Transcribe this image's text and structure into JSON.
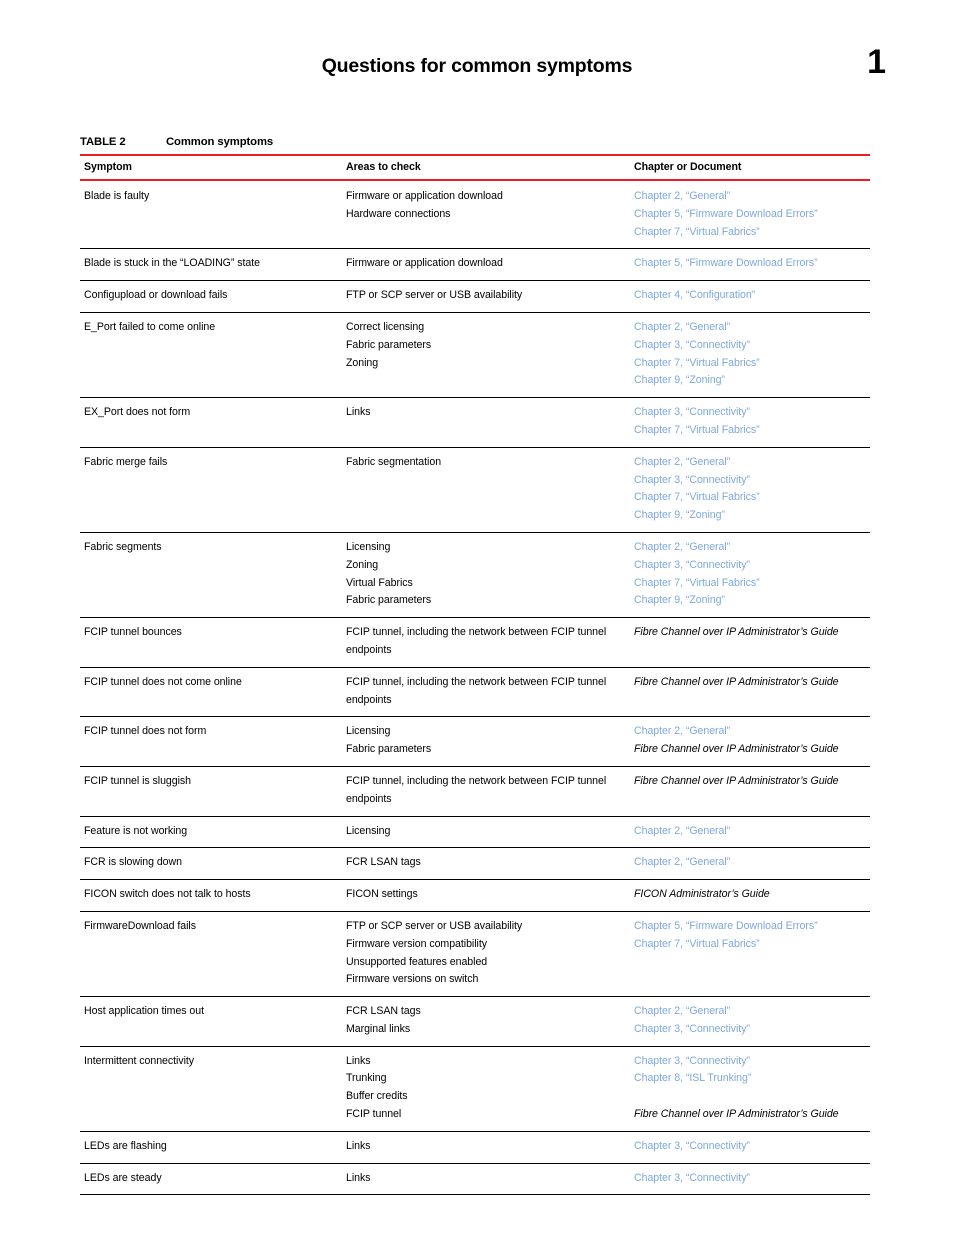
{
  "page": {
    "title": "Questions for common symptoms",
    "number": "1"
  },
  "table": {
    "label": "TABLE 2",
    "caption": "Common symptoms",
    "columns": [
      "Symptom",
      "Areas to check",
      "Chapter or Document"
    ],
    "accent_color": "#ED1C24",
    "link_color": "#7FA8DB",
    "rows": [
      {
        "symptom": "Blade is faulty",
        "areas": [
          "Firmware or application download",
          "Hardware connections"
        ],
        "refs": [
          {
            "text": "Chapter 2, “General”",
            "style": "link"
          },
          {
            "text": "Chapter 5, “Firmware Download Errors”",
            "style": "link"
          },
          {
            "text": "Chapter 7, “Virtual Fabrics”",
            "style": "link"
          }
        ]
      },
      {
        "symptom": "Blade is stuck in the “LOADING” state",
        "areas": [
          "Firmware or application download"
        ],
        "refs": [
          {
            "text": "Chapter 5, “Firmware Download Errors”",
            "style": "link"
          }
        ]
      },
      {
        "symptom": "Configupload or download fails",
        "areas": [
          "FTP or SCP server or USB availability"
        ],
        "refs": [
          {
            "text": "Chapter 4, “Configuration”",
            "style": "link"
          }
        ]
      },
      {
        "symptom": "E_Port failed to come online",
        "areas": [
          "Correct licensing",
          "Fabric parameters",
          "Zoning"
        ],
        "refs": [
          {
            "text": "Chapter 2, “General”",
            "style": "link"
          },
          {
            "text": "Chapter 3, “Connectivity”",
            "style": "link"
          },
          {
            "text": "Chapter 7, “Virtual Fabrics”",
            "style": "link"
          },
          {
            "text": "Chapter 9, “Zoning”",
            "style": "link"
          }
        ]
      },
      {
        "symptom": "EX_Port does not form",
        "areas": [
          "Links"
        ],
        "refs": [
          {
            "text": "Chapter 3, “Connectivity”",
            "style": "link"
          },
          {
            "text": "Chapter 7, “Virtual Fabrics”",
            "style": "link"
          }
        ]
      },
      {
        "symptom": "Fabric merge fails",
        "areas": [
          "Fabric segmentation"
        ],
        "refs": [
          {
            "text": "Chapter 2, “General”",
            "style": "link"
          },
          {
            "text": "Chapter 3, “Connectivity”",
            "style": "link"
          },
          {
            "text": "Chapter 7, “Virtual Fabrics”",
            "style": "link"
          },
          {
            "text": "Chapter 9, “Zoning”",
            "style": "link"
          }
        ]
      },
      {
        "symptom": "Fabric segments",
        "areas": [
          "Licensing",
          "Zoning",
          "Virtual Fabrics",
          "Fabric parameters"
        ],
        "refs": [
          {
            "text": "Chapter 2, “General”",
            "style": "link"
          },
          {
            "text": "Chapter 3, “Connectivity”",
            "style": "link"
          },
          {
            "text": "Chapter 7, “Virtual Fabrics”",
            "style": "link"
          },
          {
            "text": "Chapter 9, “Zoning”",
            "style": "link"
          }
        ]
      },
      {
        "symptom": "FCIP tunnel bounces",
        "areas": [
          "FCIP tunnel, including the network between FCIP tunnel endpoints"
        ],
        "areas_wrap": true,
        "refs": [
          {
            "text": "Fibre Channel over IP Administrator’s Guide",
            "style": "italic-wrap"
          }
        ]
      },
      {
        "symptom": "FCIP tunnel does not come online",
        "areas": [
          "FCIP tunnel, including the network between FCIP tunnel endpoints"
        ],
        "areas_wrap": true,
        "refs": [
          {
            "text": "Fibre Channel over IP Administrator’s Guide",
            "style": "italic-wrap"
          }
        ]
      },
      {
        "symptom": "FCIP tunnel does not form",
        "areas": [
          "Licensing",
          "Fabric parameters"
        ],
        "refs": [
          {
            "text": "Chapter 2, “General”",
            "style": "link"
          },
          {
            "text": "Fibre Channel over IP Administrator’s Guide",
            "style": "italic-wrap"
          }
        ]
      },
      {
        "symptom": "FCIP tunnel is sluggish",
        "areas": [
          "FCIP tunnel, including the network between FCIP tunnel endpoints"
        ],
        "areas_wrap": true,
        "refs": [
          {
            "text": "Fibre Channel over IP Administrator’s Guide",
            "style": "italic-wrap"
          }
        ]
      },
      {
        "symptom": "Feature is not working",
        "areas": [
          "Licensing"
        ],
        "refs": [
          {
            "text": "Chapter 2, “General”",
            "style": "link"
          }
        ]
      },
      {
        "symptom": "FCR is slowing down",
        "areas": [
          "FCR LSAN tags"
        ],
        "refs": [
          {
            "text": "Chapter 2, “General”",
            "style": "link"
          }
        ]
      },
      {
        "symptom": "FICON switch does not talk to hosts",
        "areas": [
          "FICON settings"
        ],
        "refs": [
          {
            "text": "FICON Administrator’s Guide",
            "style": "italic"
          }
        ]
      },
      {
        "symptom": "FirmwareDownload fails",
        "areas": [
          "FTP or SCP server or USB availability",
          "Firmware version compatibility",
          "Unsupported features enabled",
          "Firmware versions on switch"
        ],
        "refs": [
          {
            "text": "Chapter 5, “Firmware Download Errors”",
            "style": "link"
          },
          {
            "text": "Chapter 7, “Virtual Fabrics”",
            "style": "link"
          }
        ]
      },
      {
        "symptom": "Host application times out",
        "areas": [
          "FCR LSAN tags",
          "Marginal links"
        ],
        "refs": [
          {
            "text": "Chapter 2, “General”",
            "style": "link"
          },
          {
            "text": "Chapter 3, “Connectivity”",
            "style": "link"
          }
        ]
      },
      {
        "symptom": "Intermittent connectivity",
        "areas": [
          "Links",
          "Trunking",
          "Buffer credits",
          "FCIP tunnel"
        ],
        "refs": [
          {
            "text": "Chapter 3, “Connectivity”",
            "style": "link"
          },
          {
            "text": "Chapter 8, “ISL Trunking”",
            "style": "link"
          },
          {
            "text": "",
            "style": "blank"
          },
          {
            "text": "Fibre Channel over IP Administrator’s Guide",
            "style": "italic-wrap"
          }
        ]
      },
      {
        "symptom": "LEDs are flashing",
        "areas": [
          "Links"
        ],
        "refs": [
          {
            "text": "Chapter 3, “Connectivity”",
            "style": "link"
          }
        ]
      },
      {
        "symptom": "LEDs are steady",
        "areas": [
          "Links"
        ],
        "refs": [
          {
            "text": "Chapter 3, “Connectivity”",
            "style": "link"
          }
        ]
      }
    ]
  }
}
